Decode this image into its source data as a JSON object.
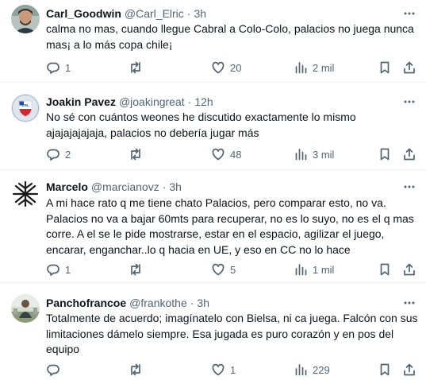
{
  "tweets": [
    {
      "name": "Carl_Goodwin",
      "handle": "@Carl_Elric",
      "time": "3h",
      "lines": [
        "calma no mas, cuando llegue Cabral a Colo-Colo, palacios no juega nunca",
        "mas¡ a lo más copa chile¡"
      ],
      "replies": "1",
      "retweets": "",
      "likes": "20",
      "views": "2 mil"
    },
    {
      "name": "Joakin Pavez",
      "handle": "@joakingreat",
      "time": "12h",
      "avatar_text": "CRL",
      "lines": [
        "No sé con cuántos weones he discutido exactamente lo mismo",
        "ajajajajajaja, palacios no debería jugar más"
      ],
      "replies": "2",
      "retweets": "",
      "likes": "48",
      "views": "3 mil"
    },
    {
      "name": "Marcelo",
      "handle": "@marcianovz",
      "time": "3h",
      "lines": [
        "A mi hace rato q me tiene chato Palacios, pero comparar esto, no va.",
        "Palacios no va a bajar 60mts para recuperar, no es lo suyo, no es el q mas",
        "corre. A el se le pide mostrarse, estar en el espacio, agilizar el juego,",
        "encarar, enganchar..lo q hacia en UE, y eso en CC no lo hace"
      ],
      "replies": "1",
      "retweets": "",
      "likes": "5",
      "views": "1 mil"
    },
    {
      "name": "Panchofrancoe",
      "handle": "@frankothe",
      "time": "3h",
      "lines": [
        "Totalmente de acuerdo; imagínatelo con Bielsa, ni ca juega. Falcón con sus",
        "limitaciones dámelo siempre. Esa jugada es puro corazón y en pos del",
        "equipo"
      ],
      "replies": "",
      "retweets": "",
      "likes": "1",
      "views": "229"
    }
  ],
  "common": {
    "separator": "·"
  },
  "colors": {
    "text": "#0f1419",
    "muted": "#536471",
    "border": "#eff3f4"
  },
  "icons": [
    "more-icon",
    "reply-icon",
    "retweet-icon",
    "like-icon",
    "views-icon",
    "bookmark-icon",
    "share-icon"
  ]
}
